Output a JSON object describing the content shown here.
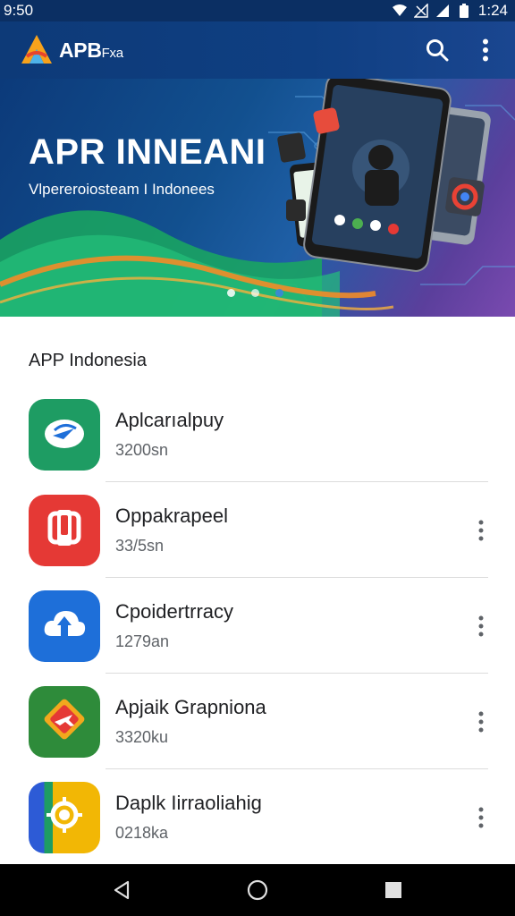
{
  "status_bar": {
    "left_text": "9:50",
    "time": "1:24",
    "icons": [
      "wifi-icon",
      "no-signal-icon",
      "signal-icon",
      "battery-icon"
    ]
  },
  "app_bar": {
    "name": "APB",
    "name_suffix": "Fxa",
    "icons": [
      "logo-icon",
      "search-icon",
      "more-vert-icon"
    ]
  },
  "banner": {
    "title": "APR INNEANI",
    "subtitle": "Vlpereroiosteam I Indonees",
    "slides": 3,
    "active_slide": 0
  },
  "section": {
    "title": "APP Indonesia"
  },
  "apps": [
    {
      "name": "Aplcarıalpuy",
      "size": "3200sn",
      "icon": "sync-cloud-icon",
      "color": "#1e9c63",
      "has_more": false
    },
    {
      "name": "Oppakrapeel",
      "size": "33/5sn",
      "icon": "device-frame-icon",
      "color": "#e53935",
      "has_more": true
    },
    {
      "name": "Cpoidertrracy",
      "size": "1279an",
      "icon": "cloud-upload-icon",
      "color": "#1e6fd9",
      "has_more": true
    },
    {
      "name": "Apjaik Grapniona",
      "size": "3320ku",
      "icon": "plane-tag-icon",
      "color": "#2e8b3a",
      "has_more": true
    },
    {
      "name": "Daplk Iirraoliahig",
      "size": "0218ka",
      "icon": "target-icon",
      "color": "#f2b705",
      "has_more": true
    }
  ],
  "nav": {
    "icons": [
      "back-icon",
      "home-icon",
      "recents-icon"
    ]
  },
  "colors": {
    "app_bar": "#0d3a78",
    "banner_start": "#0c3a7a",
    "banner_end": "#7a4ab0",
    "nav_bar": "#000000"
  }
}
